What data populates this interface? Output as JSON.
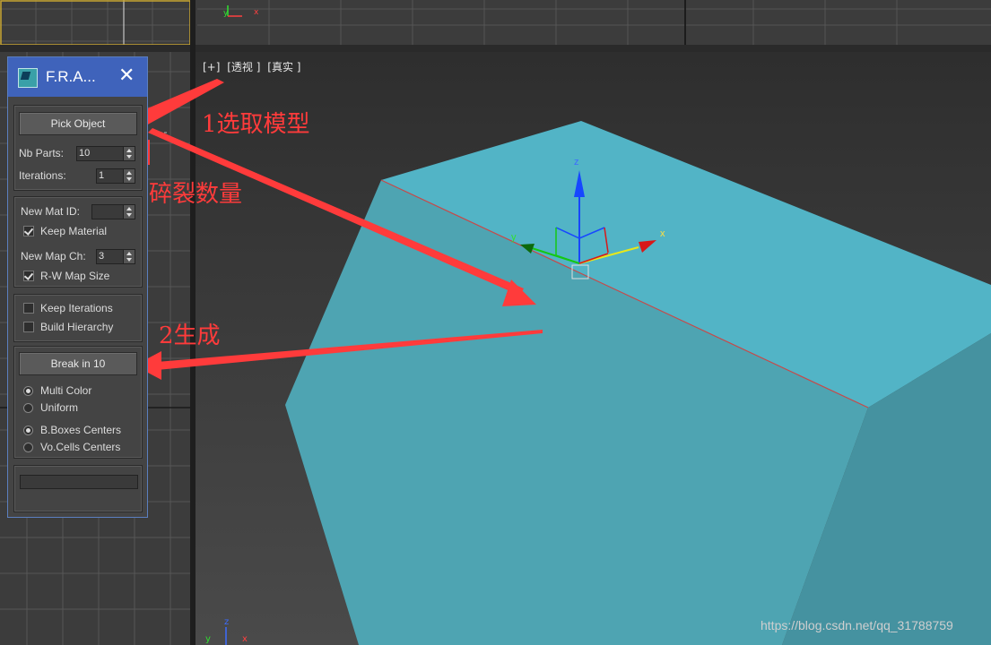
{
  "viewport": {
    "label_items": [
      "[+]",
      "[透视 ]",
      "[真实 ]"
    ],
    "background_color": "#3c3c3c",
    "object_color": "#52b4c6"
  },
  "gizmo": {
    "axis_x": "x",
    "axis_y": "y",
    "axis_z": "z"
  },
  "nav_axes": {
    "top_y": "y",
    "top_x": "x",
    "bottom_y": "y",
    "bottom_z": "z",
    "bottom_x": "x"
  },
  "panel": {
    "title": "F.R.A...",
    "close_symbol": "✕",
    "pick_object_label": "Pick Object",
    "nb_parts_label": "Nb Parts:",
    "nb_parts_value": "10",
    "iterations_label": "Iterations:",
    "iterations_value": "1",
    "new_mat_id_label": "New Mat ID:",
    "new_mat_id_value": "",
    "keep_material_label": "Keep Material",
    "keep_material_checked": true,
    "new_map_ch_label": "New Map Ch:",
    "new_map_ch_value": "3",
    "rw_map_size_label": "R-W Map Size",
    "rw_map_size_checked": true,
    "keep_iterations_label": "Keep Iterations",
    "keep_iterations_checked": false,
    "build_hierarchy_label": "Build Hierarchy",
    "build_hierarchy_checked": false,
    "break_button_label": "Break in 10",
    "multi_color_label": "Multi Color",
    "multi_color_selected": true,
    "uniform_label": "Uniform",
    "uniform_selected": false,
    "bboxes_centers_label": "B.Boxes Centers",
    "bboxes_centers_selected": true,
    "vocells_centers_label": "Vo.Cells Centers",
    "vocells_centers_selected": false
  },
  "annotations": {
    "step1": "1选取模型",
    "fragment_count": "碎裂数量",
    "step2": "2生成",
    "color": "#ff3b3b"
  },
  "watermark": "https://blog.csdn.net/qq_31788759"
}
